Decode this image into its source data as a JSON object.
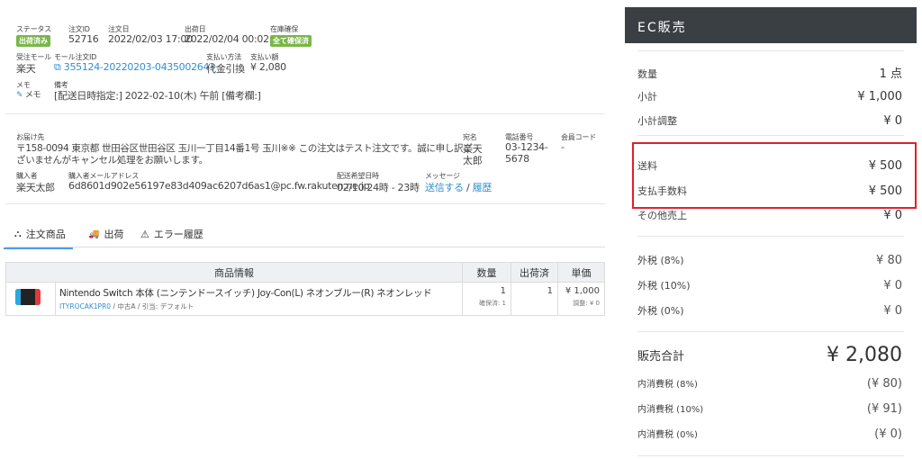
{
  "order": {
    "status_label": "ステータス",
    "status_badge": "出荷済み",
    "order_id_label": "注文ID",
    "order_id": "52716",
    "order_date_label": "注文日",
    "order_date": "2022/02/03 17:00",
    "ship_date_label": "出荷日",
    "ship_date": "2022/02/04 00:02",
    "stock_label": "在庫確保",
    "stock_badge": "全て確保済",
    "mall_label": "受注モール",
    "mall": "楽天",
    "mall_order_id_label": "モール注文ID",
    "mall_order_id": "355124-20220203-0435002643",
    "payment_method_label": "支払い方法",
    "payment_method": "代金引換",
    "payment_amount_label": "支払い額",
    "payment_amount": "¥ 2,080",
    "memo_label": "メモ",
    "memo_button": "メモ",
    "remarks_label": "備考",
    "remarks": "[配送日時指定:] 2022-02-10(木) 午前 [備考欄:]"
  },
  "delivery": {
    "address_label": "お届け先",
    "address_line1": "〒158-0094 東京都 世田谷区世田谷区 玉川一丁目14番1号 玉川※※ この注文はテスト注文です。誠に申し訳ご",
    "address_line2": "ざいませんがキャンセル処理をお願いします。",
    "recipient_label": "宛名",
    "recipient_line1": "楽天",
    "recipient_line2": "太郎",
    "phone_label": "電話番号",
    "phone_line1": "03-1234-",
    "phone_line2": "5678",
    "member_code_label": "会員コード",
    "member_code": "-",
    "buyer_label": "購入者",
    "buyer": "楽天太郎",
    "buyer_email_label": "購入者メールアドレス",
    "buyer_email": "6d8601d902e56197e83d409ac6207d6as1@pc.fw.rakuten.ne.jp",
    "delivery_time_label": "配送希望日時",
    "delivery_time": "02/10 24時 - 23時",
    "message_label": "メッセージ",
    "message_send": "送信する",
    "message_sep": "/",
    "message_history": "履歴"
  },
  "tabs": [
    {
      "label": "注文商品",
      "icon": "cubes-icon",
      "active": true
    },
    {
      "label": "出荷",
      "icon": "truck-icon",
      "active": false
    },
    {
      "label": "エラー履歴",
      "icon": "warning-icon",
      "active": false
    }
  ],
  "items_table": {
    "headers": [
      "商品情報",
      "数量",
      "出荷済",
      "単価"
    ],
    "rows": [
      {
        "name": "Nintendo Switch 本体 (ニンテンドースイッチ) Joy-Con(L) ネオンブルー(R) ネオンレッド",
        "sku": "ITYROCAK1PR0",
        "sub": " / 中古A / 引当: デフォルト",
        "qty": "1",
        "qty_sub": "確保済: 1",
        "shipped": "1",
        "price": "¥ 1,000",
        "price_sub": "調整: ¥ 0"
      }
    ]
  },
  "summary": {
    "title": "EC販売",
    "qty_label": "数量",
    "qty_value": "1 点",
    "subtotal_label": "小計",
    "subtotal_value": "¥ 1,000",
    "subtotal_adj_label": "小計調整",
    "subtotal_adj_value": "¥ 0",
    "shipping_label": "送料",
    "shipping_value": "¥ 500",
    "fee_label": "支払手数料",
    "fee_value": "¥ 500",
    "other_label": "その他売上",
    "other_value": "¥ 0",
    "tax8_label": "外税 (8%)",
    "tax8_value": "¥ 80",
    "tax10_label": "外税 (10%)",
    "tax10_value": "¥ 0",
    "tax0_label": "外税 (0%)",
    "tax0_value": "¥ 0",
    "total_label": "販売合計",
    "total_value": "¥ 2,080",
    "incl8_label": "内消費税 (8%)",
    "incl8_value": "(¥ 80)",
    "incl10_label": "内消費税 (10%)",
    "incl10_value": "(¥ 91)",
    "incl0_label": "内消費税 (0%)",
    "incl0_value": "(¥ 0)"
  },
  "colors": {
    "badge_green": "#7ab648",
    "link_blue": "#2f8fd1",
    "panel_header": "#3a3f44",
    "highlight_red": "#e0202a"
  }
}
